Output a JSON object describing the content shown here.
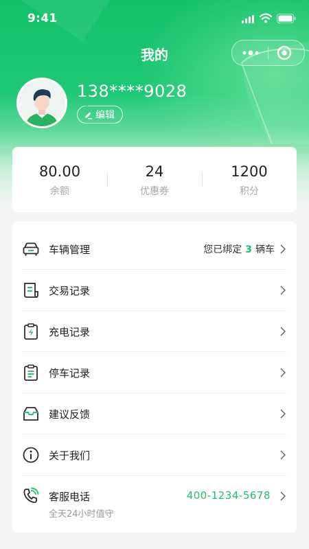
{
  "status_bar": {
    "time": "9:41"
  },
  "header": {
    "title": "我的"
  },
  "profile": {
    "phone": "138****9028",
    "edit_label": "编辑"
  },
  "stats": [
    {
      "value": "80.00",
      "label": "余额"
    },
    {
      "value": "24",
      "label": "优惠券"
    },
    {
      "value": "1200",
      "label": "积分"
    }
  ],
  "menu": {
    "vehicles": {
      "label": "车辆管理",
      "hint_prefix": "您已绑定",
      "count": "3",
      "hint_suffix": "辆车"
    },
    "transactions": {
      "label": "交易记录"
    },
    "charging": {
      "label": "充电记录"
    },
    "parking": {
      "label": "停车记录"
    },
    "feedback": {
      "label": "建议反馈"
    },
    "about": {
      "label": "关于我们"
    },
    "service": {
      "label": "客服电话",
      "phone": "400-1234-5678",
      "sub": "全天24小时值守"
    }
  },
  "colors": {
    "brand_green": "#1fc06f",
    "header_green": "#14c068"
  },
  "icons": [
    "signal-icon",
    "wifi-icon",
    "battery-icon",
    "more-dots-icon",
    "target-icon",
    "pencil-icon",
    "car-icon",
    "receipt-icon",
    "charge-clipboard-icon",
    "parking-clipboard-icon",
    "mail-tray-icon",
    "info-icon",
    "phone-icon",
    "chevron-right-icon"
  ]
}
